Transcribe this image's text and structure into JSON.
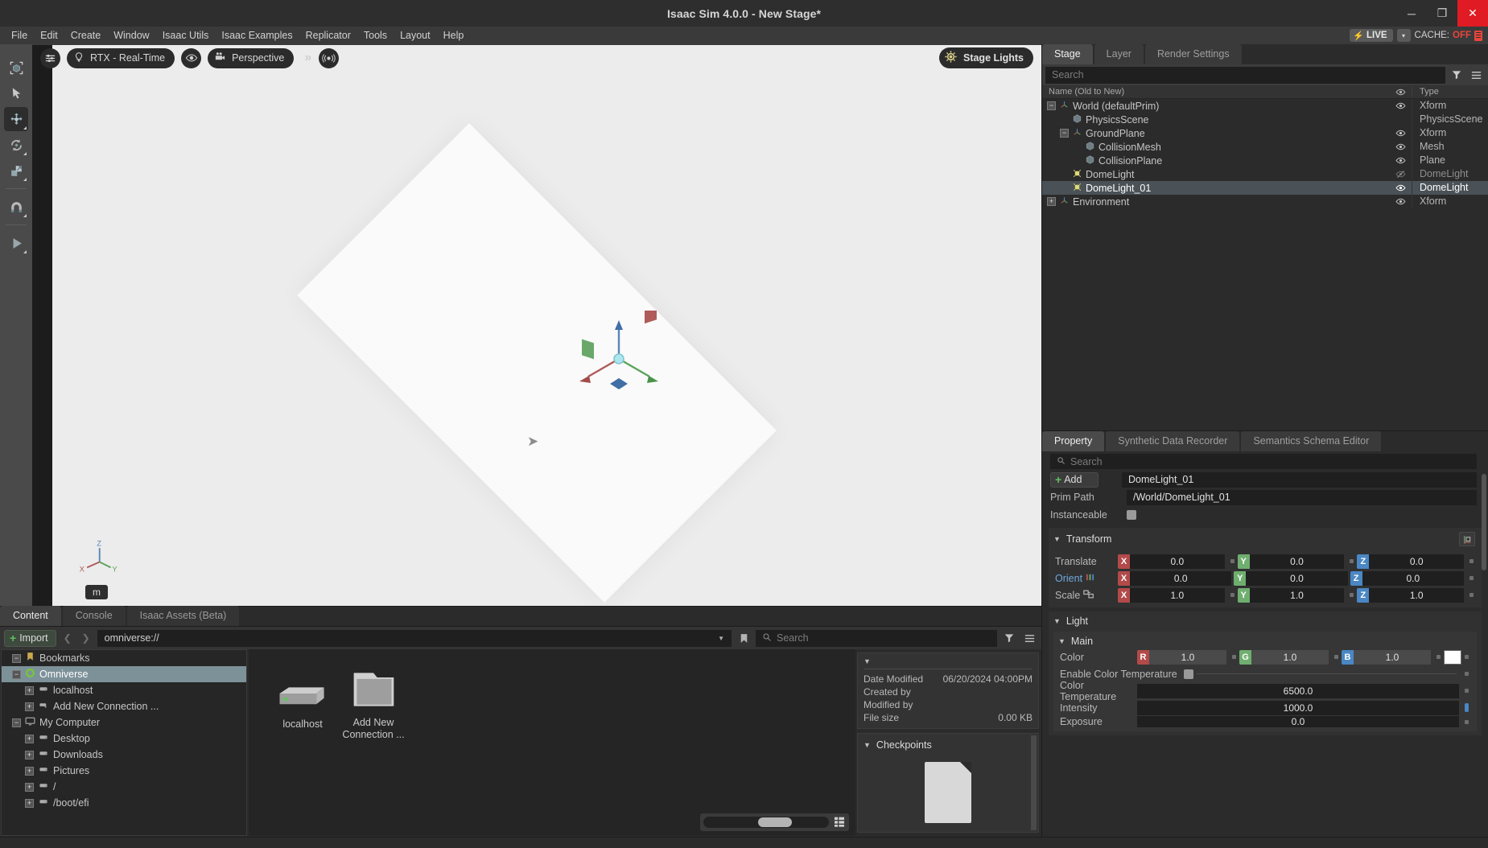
{
  "window": {
    "title": "Isaac Sim 4.0.0 - New Stage*",
    "minimize": "─",
    "maximize": "❐",
    "close": "✕"
  },
  "menubar": {
    "items": [
      "File",
      "Edit",
      "Create",
      "Window",
      "Isaac Utils",
      "Isaac Examples",
      "Replicator",
      "Tools",
      "Layout",
      "Help"
    ],
    "live_label": "LIVE",
    "live_dropdown": "▾",
    "cache_label": "CACHE:",
    "cache_value": "OFF"
  },
  "viewport_toolbar": {
    "tools": [
      {
        "name": "select-bounds-tool"
      },
      {
        "name": "select-tool"
      },
      {
        "name": "move-tool",
        "active": true
      },
      {
        "name": "rotate-tool"
      },
      {
        "name": "scale-tool"
      },
      {
        "name": "snap-tool"
      },
      {
        "name": "play-tool"
      }
    ]
  },
  "viewport": {
    "renderer": "RTX - Real-Time",
    "camera": "Perspective",
    "stage_lights": "Stage Lights",
    "unit": "m",
    "axis_x": "X",
    "axis_y": "Y",
    "axis_z": "Z"
  },
  "stage": {
    "tabs": [
      {
        "label": "Stage",
        "active": true
      },
      {
        "label": "Layer",
        "active": false
      },
      {
        "label": "Render Settings",
        "active": false
      }
    ],
    "search_placeholder": "Search",
    "columns": {
      "name": "Name (Old to New)",
      "type": "Type"
    },
    "rows": [
      {
        "label": "World (defaultPrim)",
        "type": "Xform",
        "depth": 0,
        "expander": "−",
        "icon": "xform-icon",
        "visible": true,
        "selected": false
      },
      {
        "label": "PhysicsScene",
        "type": "PhysicsScene",
        "depth": 1,
        "expander": "",
        "icon": "mesh-icon",
        "visible": false,
        "selected": false
      },
      {
        "label": "GroundPlane",
        "type": "Xform",
        "depth": 1,
        "expander": "−",
        "icon": "xform-icon",
        "visible": true,
        "selected": false
      },
      {
        "label": "CollisionMesh",
        "type": "Mesh",
        "depth": 2,
        "expander": "",
        "icon": "mesh-icon",
        "visible": true,
        "selected": false
      },
      {
        "label": "CollisionPlane",
        "type": "Plane",
        "depth": 2,
        "expander": "",
        "icon": "mesh-icon",
        "visible": true,
        "selected": false
      },
      {
        "label": "DomeLight",
        "type": "DomeLight",
        "depth": 1,
        "expander": "",
        "icon": "light-icon",
        "visible": false,
        "hidden_eye": true,
        "selected": false
      },
      {
        "label": "DomeLight_01",
        "type": "DomeLight",
        "depth": 1,
        "expander": "",
        "icon": "light-icon",
        "visible": true,
        "selected": true
      },
      {
        "label": "Environment",
        "type": "Xform",
        "depth": 0,
        "expander": "+",
        "icon": "xform-icon",
        "visible": true,
        "selected": false
      }
    ]
  },
  "property": {
    "tabs": [
      {
        "label": "Property",
        "active": true
      },
      {
        "label": "Synthetic Data Recorder",
        "active": false
      },
      {
        "label": "Semantics Schema Editor",
        "active": false
      }
    ],
    "search_placeholder": "Search",
    "add_label": "Add",
    "prim_name": "DomeLight_01",
    "prim_path_label": "Prim Path",
    "prim_path_value": "/World/DomeLight_01",
    "instanceable_label": "Instanceable",
    "transform": {
      "title": "Transform",
      "translate_label": "Translate",
      "translate": [
        "0.0",
        "0.0",
        "0.0"
      ],
      "orient_label": "Orient",
      "orient": [
        "0.0",
        "0.0",
        "0.0"
      ],
      "scale_label": "Scale",
      "scale": [
        "1.0",
        "1.0",
        "1.0"
      ],
      "axes": [
        "X",
        "Y",
        "Z"
      ]
    },
    "light": {
      "title": "Light",
      "main_title": "Main",
      "color_label": "Color",
      "color_channels": [
        "R",
        "G",
        "B"
      ],
      "color": [
        "1.0",
        "1.0",
        "1.0"
      ],
      "color_hex": "#ffffff",
      "enable_color_temperature_label": "Enable Color Temperature",
      "color_temperature_label": "Color Temperature",
      "color_temperature": "6500.0",
      "intensity_label": "Intensity",
      "intensity": "1000.0",
      "exposure_label": "Exposure",
      "exposure": "0.0"
    }
  },
  "content": {
    "tabs": [
      {
        "label": "Content",
        "active": true
      },
      {
        "label": "Console",
        "active": false
      },
      {
        "label": "Isaac Assets (Beta)",
        "active": false
      }
    ],
    "import_label": "Import",
    "path": "omniverse://",
    "search_placeholder": "Search",
    "tree": [
      {
        "label": "Bookmarks",
        "depth": 0,
        "expander": "−",
        "icon": "bookmark-icon",
        "selected": false
      },
      {
        "label": "Omniverse",
        "depth": 0,
        "expander": "−",
        "icon": "omniverse-icon",
        "selected": true
      },
      {
        "label": "localhost",
        "depth": 1,
        "expander": "+",
        "icon": "server-icon",
        "selected": false
      },
      {
        "label": "Add New Connection ...",
        "depth": 1,
        "expander": "+",
        "icon": "add-connection-icon",
        "selected": false
      },
      {
        "label": "My Computer",
        "depth": 0,
        "expander": "−",
        "icon": "computer-icon",
        "selected": false
      },
      {
        "label": "Desktop",
        "depth": 1,
        "expander": "+",
        "icon": "server-icon",
        "selected": false
      },
      {
        "label": "Downloads",
        "depth": 1,
        "expander": "+",
        "icon": "server-icon",
        "selected": false
      },
      {
        "label": "Pictures",
        "depth": 1,
        "expander": "+",
        "icon": "server-icon",
        "selected": false
      },
      {
        "label": "/",
        "depth": 1,
        "expander": "+",
        "icon": "server-icon",
        "selected": false
      },
      {
        "label": "/boot/efi",
        "depth": 1,
        "expander": "+",
        "icon": "server-icon",
        "selected": false
      }
    ],
    "grid_items": [
      {
        "label": "localhost",
        "icon": "drive-icon"
      },
      {
        "label": "Add New Connection ...",
        "icon": "folder-icon"
      }
    ],
    "details": {
      "date_modified_label": "Date Modified",
      "date_modified_value": "06/20/2024 04:00PM",
      "created_by_label": "Created by",
      "created_by_value": "",
      "modified_by_label": "Modified by",
      "modified_by_value": "",
      "file_size_label": "File size",
      "file_size_value": "0.00 KB",
      "checkpoints_label": "Checkpoints"
    }
  }
}
